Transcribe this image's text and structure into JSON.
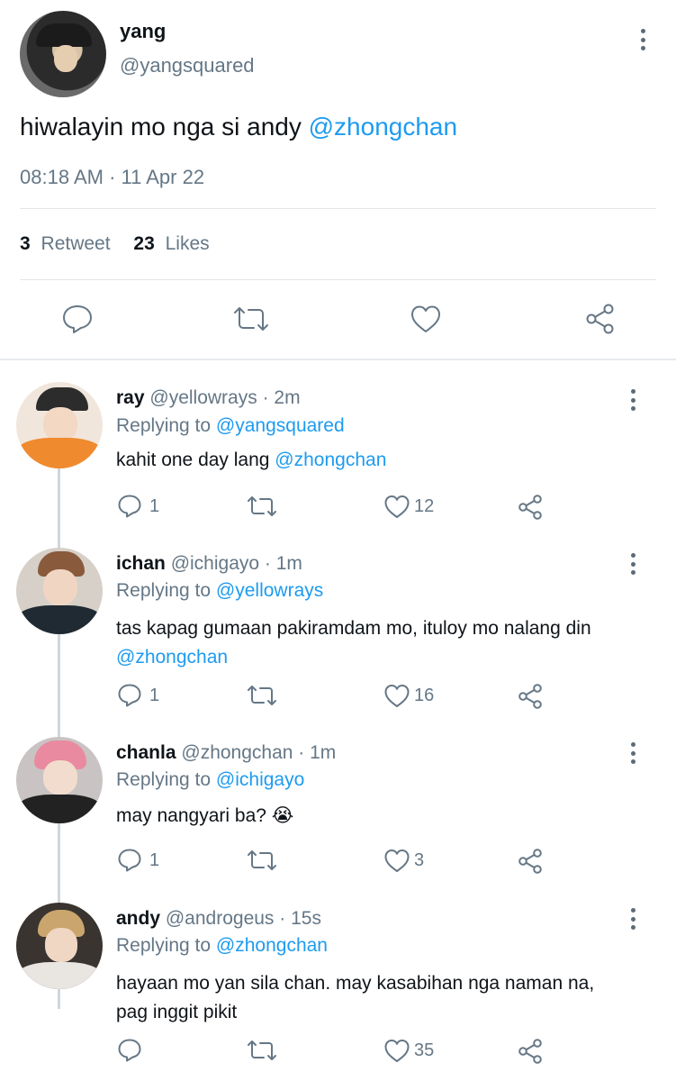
{
  "tweet": {
    "name": "yang",
    "handle": "@yangsquared",
    "text": "hiwalayin mo nga si andy ",
    "mention": "@zhongchan",
    "timestamp": "08:18 AM · 11 Apr 22",
    "retweet_count": "3",
    "retweet_label": "Retweet",
    "likes_count": "23",
    "likes_label": "Likes"
  },
  "replies": [
    {
      "name": "ray",
      "handle": "@yellowrays",
      "time": "· 2m",
      "replying_prefix": "Replying to ",
      "replying_to": "@yangsquared",
      "line1": "kahit one day lang ",
      "line1_mention": "@zhongchan",
      "line2": "",
      "reply_count": "1",
      "like_count": "12"
    },
    {
      "name": "ichan",
      "handle": "@ichigayo",
      "time": "· 1m",
      "replying_prefix": "Replying to ",
      "replying_to": "@yellowrays",
      "line1": "tas kapag gumaan pakiramdam mo, ituloy mo nalang din",
      "line1_mention": "",
      "line2": "@zhongchan",
      "reply_count": "1",
      "like_count": "16"
    },
    {
      "name": "chanla",
      "handle": "@zhongchan",
      "time": "· 1m",
      "replying_prefix": "Replying to ",
      "replying_to": "@ichigayo",
      "line1": "may nangyari ba? ",
      "emoji": "😭",
      "line2": "",
      "reply_count": "1",
      "like_count": "3"
    },
    {
      "name": "andy",
      "handle": "@androgeus",
      "time": "· 15s",
      "replying_prefix": "Replying to ",
      "replying_to": "@zhongchan",
      "line1": "hayaan mo yan sila chan. may kasabihan nga naman na,",
      "line2": "pag inggit pikit",
      "reply_count": "",
      "like_count": "35"
    }
  ],
  "colors": {
    "link": "#1d9bf0",
    "muted": "#657786",
    "text": "#0f1419"
  },
  "icons": [
    "more-vertical-icon",
    "reply-icon",
    "retweet-icon",
    "heart-icon",
    "share-icon"
  ]
}
